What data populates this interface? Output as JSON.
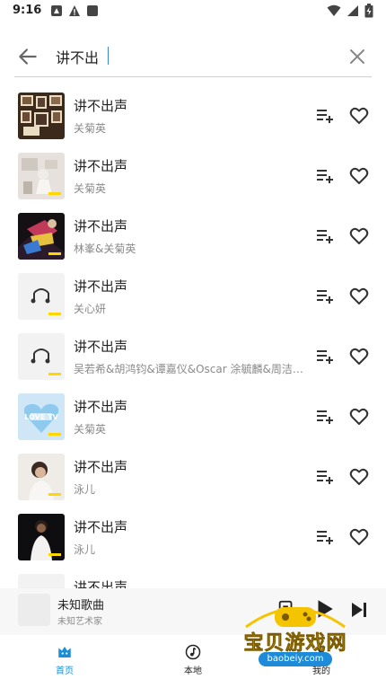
{
  "status_bar": {
    "time": "9:16"
  },
  "search": {
    "query": "讲不出"
  },
  "songs": [
    {
      "title": "讲不出声",
      "artist": "关菊英",
      "cover": "photo-collage"
    },
    {
      "title": "讲不出声",
      "artist": "关菊英",
      "cover": "white-room"
    },
    {
      "title": "讲不出声",
      "artist": "林峯&关菊英",
      "cover": "dark-colorful"
    },
    {
      "title": "讲不出声",
      "artist": "关心妍",
      "cover": "placeholder"
    },
    {
      "title": "讲不出声",
      "artist": "吴若希&胡鸿钧&谭嘉仪&Oscar 涂毓麟&周洁琼&…",
      "cover": "placeholder"
    },
    {
      "title": "讲不出声",
      "artist": "关菊英",
      "cover": "love-tv"
    },
    {
      "title": "讲不出声",
      "artist": "泳儿",
      "cover": "portrait-light"
    },
    {
      "title": "讲不出声",
      "artist": "泳儿",
      "cover": "portrait-dark"
    },
    {
      "title": "讲不出声",
      "artist": "",
      "cover": "placeholder"
    }
  ],
  "mini_player": {
    "title": "未知歌曲",
    "artist": "未知艺术家"
  },
  "bottom_nav": {
    "home_label": "首页",
    "local_label": "本地",
    "mine_label": "我的"
  },
  "watermark": {
    "text": "宝贝游戏网",
    "url": "baobeiy.com"
  },
  "colors": {
    "accent": "#1a8fd8",
    "text": "#222222",
    "secondary": "#8a8a8a",
    "tag": "#ffd600"
  }
}
